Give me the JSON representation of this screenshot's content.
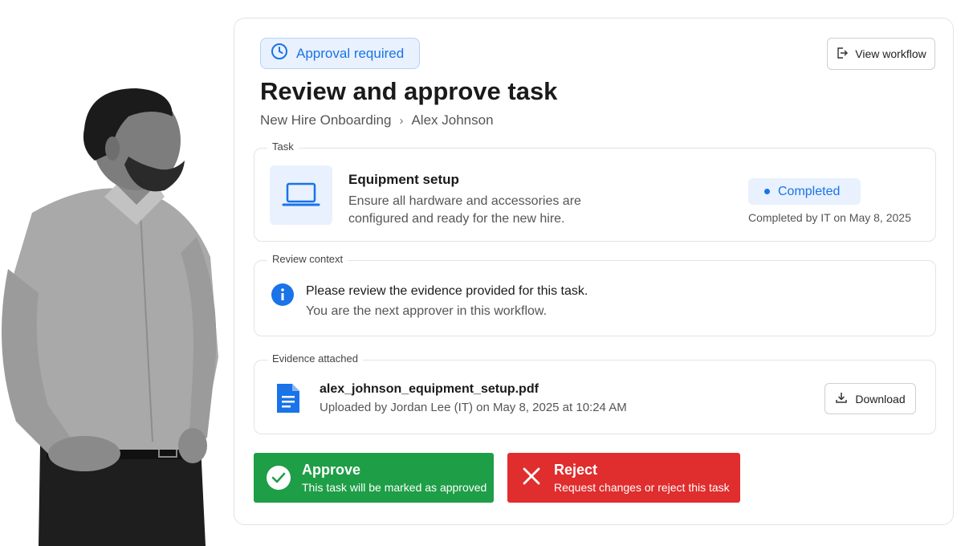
{
  "badge": {
    "label": "Approval required",
    "icon": "clock-icon"
  },
  "header": {
    "title": "Review and approve task",
    "view_workflow_label": "View workflow",
    "breadcrumb": [
      "New Hire Onboarding",
      "Alex Johnson"
    ]
  },
  "task": {
    "section_label": "Task",
    "icon": "laptop-icon",
    "title": "Equipment setup",
    "description": "Ensure all hardware and accessories are configured and ready for the new hire.",
    "status": "Completed",
    "status_meta": "Completed by IT on May 8, 2025"
  },
  "context": {
    "section_label": "Review context",
    "line1": "Please review the evidence provided for this task.",
    "line2": "You are the next approver in this workflow."
  },
  "evidence": {
    "section_label": "Evidence attached",
    "file_name": "alex_johnson_equipment_setup.pdf",
    "file_meta": "Uploaded by Jordan Lee (IT) on May 8, 2025 at 10:24 AM",
    "download_label": "Download"
  },
  "actions": {
    "approve_title": "Approve",
    "approve_sub": "This task will be marked as approved",
    "reject_title": "Reject",
    "reject_sub": "Request changes or reject this task"
  },
  "colors": {
    "accent": "#1a73e8",
    "approve": "#1e9e46",
    "reject": "#e02d2d"
  }
}
